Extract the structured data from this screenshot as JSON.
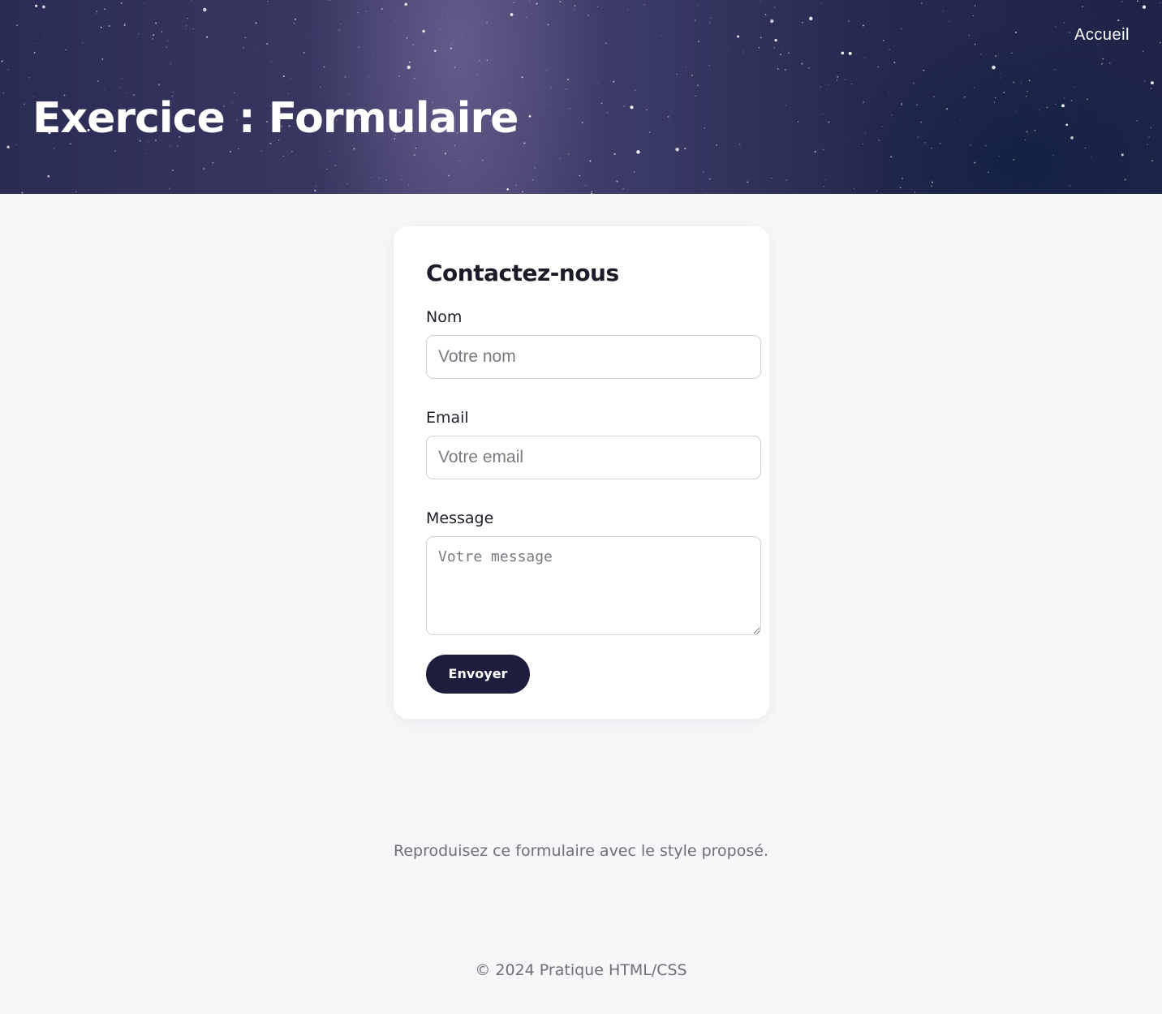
{
  "header": {
    "nav_link": "Accueil",
    "title": "Exercice : Formulaire"
  },
  "form": {
    "title": "Contactez-nous",
    "name_label": "Nom",
    "name_placeholder": "Votre nom",
    "email_label": "Email",
    "email_placeholder": "Votre email",
    "message_label": "Message",
    "message_placeholder": "Votre message",
    "submit_label": "Envoyer"
  },
  "instruction": "Reproduisez ce formulaire avec le style proposé.",
  "footer": "© 2024 Pratique HTML/CSS",
  "colors": {
    "button_bg": "#1f1d3d",
    "page_bg": "#f6f7f9",
    "muted_text": "#6f6f78"
  }
}
